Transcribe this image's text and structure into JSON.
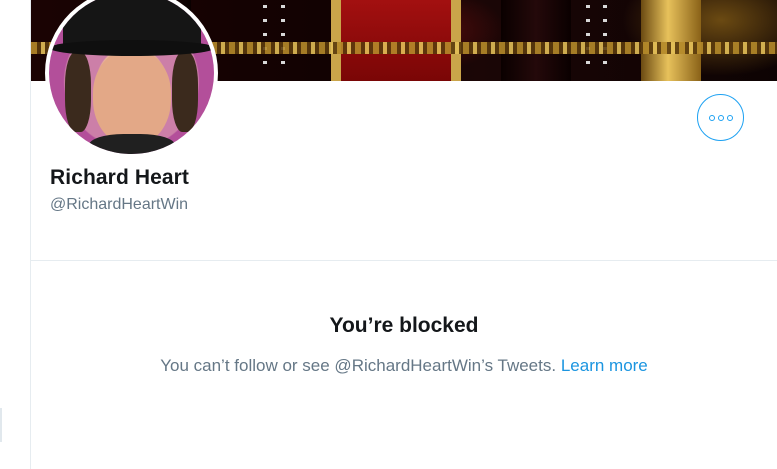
{
  "profile": {
    "display_name": "Richard Heart",
    "handle": "@RichardHeartWin"
  },
  "actions": {
    "more_icon": "more-horizontal-icon"
  },
  "blocked": {
    "title": "You’re blocked",
    "message": "You can’t follow or see @RichardHeartWin’s Tweets.",
    "link_label": "Learn more"
  },
  "colors": {
    "accent": "#1da1f2",
    "link": "#1b95e0",
    "primary_text": "#14171a",
    "secondary_text": "#657786",
    "border": "#e6ecf0"
  }
}
